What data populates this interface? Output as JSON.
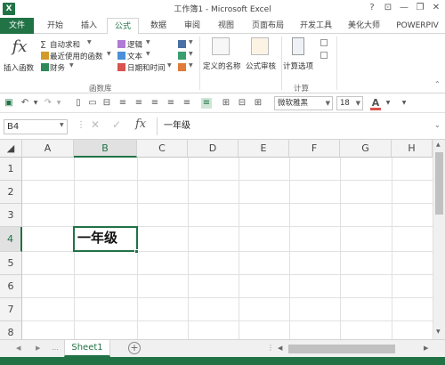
{
  "window": {
    "title": "工作簿1 - Microsoft Excel",
    "help": "?",
    "minimize": "—",
    "restore": "❐",
    "close": "✕"
  },
  "tabs": [
    "文件",
    "开始",
    "插入",
    "公式",
    "数据",
    "审阅",
    "视图",
    "页面布局",
    "开发工具",
    "美化大师",
    "POWERPIV"
  ],
  "active_tab_index": 3,
  "ribbon": {
    "insert_function": "插入函数",
    "autosum": "自动求和",
    "recent": "最近使用的函数",
    "financial": "财务",
    "logical": "逻辑",
    "text": "文本",
    "datetime": "日期和时间",
    "group_function_library": "函数库",
    "defined_names": "定义的名称",
    "formula_auditing": "公式审核",
    "calc_options": "计算选项",
    "group_calculation": "计算"
  },
  "qat": {
    "font_name": "微软雅黑",
    "font_size": "18",
    "font_color_letter": "A"
  },
  "formula_bar": {
    "name_box": "B4",
    "fx": "fx",
    "value": "一年级"
  },
  "grid": {
    "columns": [
      "A",
      "B",
      "C",
      "D",
      "E",
      "F",
      "G",
      "H"
    ],
    "rows": [
      "1",
      "2",
      "3",
      "4",
      "5",
      "6",
      "7",
      "8"
    ],
    "active_cell_value": "一年级",
    "active_col": "B",
    "active_row": "4"
  },
  "sheets": {
    "tab1": "Sheet1"
  },
  "colors": {
    "accent": "#217346"
  }
}
